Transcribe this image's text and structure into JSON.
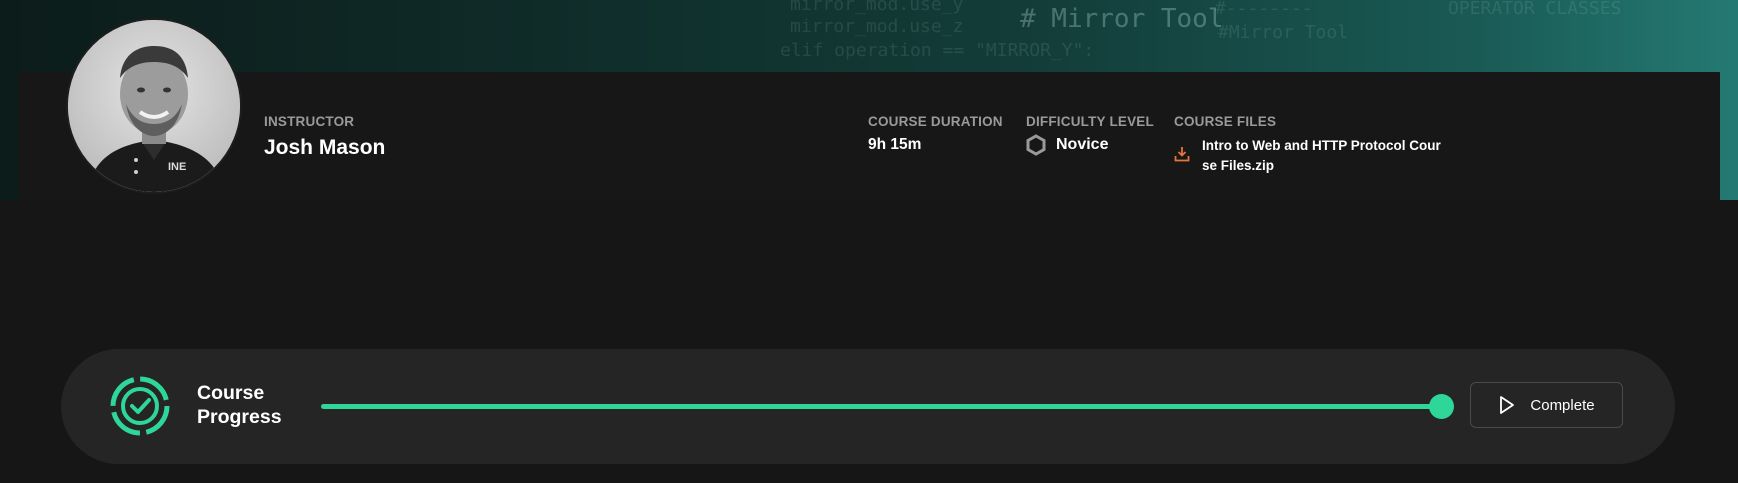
{
  "background": {
    "code_lines": [
      "mirror_mod.use_y",
      "mirror_mod.use_z",
      "elif operation == \"MIRROR_Y\":",
      "# Mirror Tool",
      "#--------",
      "#Mirror Tool",
      "OPERATOR CLASSES"
    ]
  },
  "instructor": {
    "label": "INSTRUCTOR",
    "name": "Josh Mason",
    "avatar_icon": "instructor-photo"
  },
  "course_duration": {
    "label": "COURSE DURATION",
    "value": "9h 15m"
  },
  "difficulty": {
    "label": "DIFFICULTY LEVEL",
    "value": "Novice",
    "icon": "hexagon-icon"
  },
  "course_files": {
    "label": "COURSE FILES",
    "file_name": "Intro to Web and HTTP Protocol Course Files.zip",
    "icon": "download-icon",
    "icon_color": "#e8743b"
  },
  "progress": {
    "label_line1": "Course",
    "label_line2": "Progress",
    "value_percent": 100,
    "accent_color": "#2ed69a",
    "icon": "progress-check-icon",
    "complete_button_label": "Complete",
    "complete_button_icon": "play-icon"
  }
}
